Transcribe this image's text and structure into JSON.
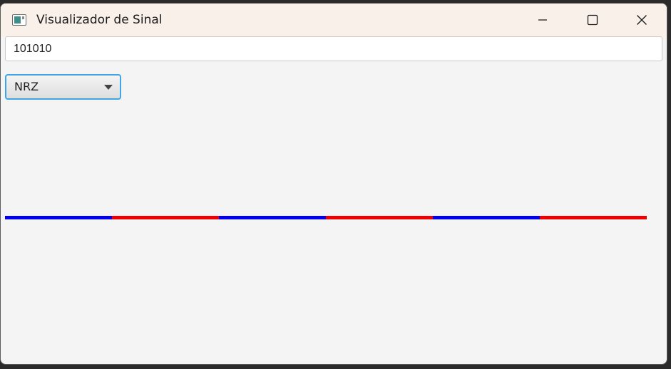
{
  "window": {
    "title": "Visualizador de Sinal",
    "icon": "app-window-icon",
    "controls": {
      "minimize_icon": "minimize-icon",
      "maximize_icon": "maximize-icon",
      "close_icon": "close-icon"
    }
  },
  "input": {
    "value": "101010"
  },
  "encoding_select": {
    "selected": "NRZ",
    "icon": "chevron-down-icon"
  },
  "signal": {
    "bits": [
      1,
      0,
      1,
      0,
      1,
      0
    ],
    "colors": {
      "one": "#0000ee",
      "zero": "#ee0000"
    }
  },
  "colors": {
    "focus_accent": "#3fa6e6",
    "titlebar_bg": "#f9f0ea",
    "content_bg": "#f4f4f4"
  }
}
